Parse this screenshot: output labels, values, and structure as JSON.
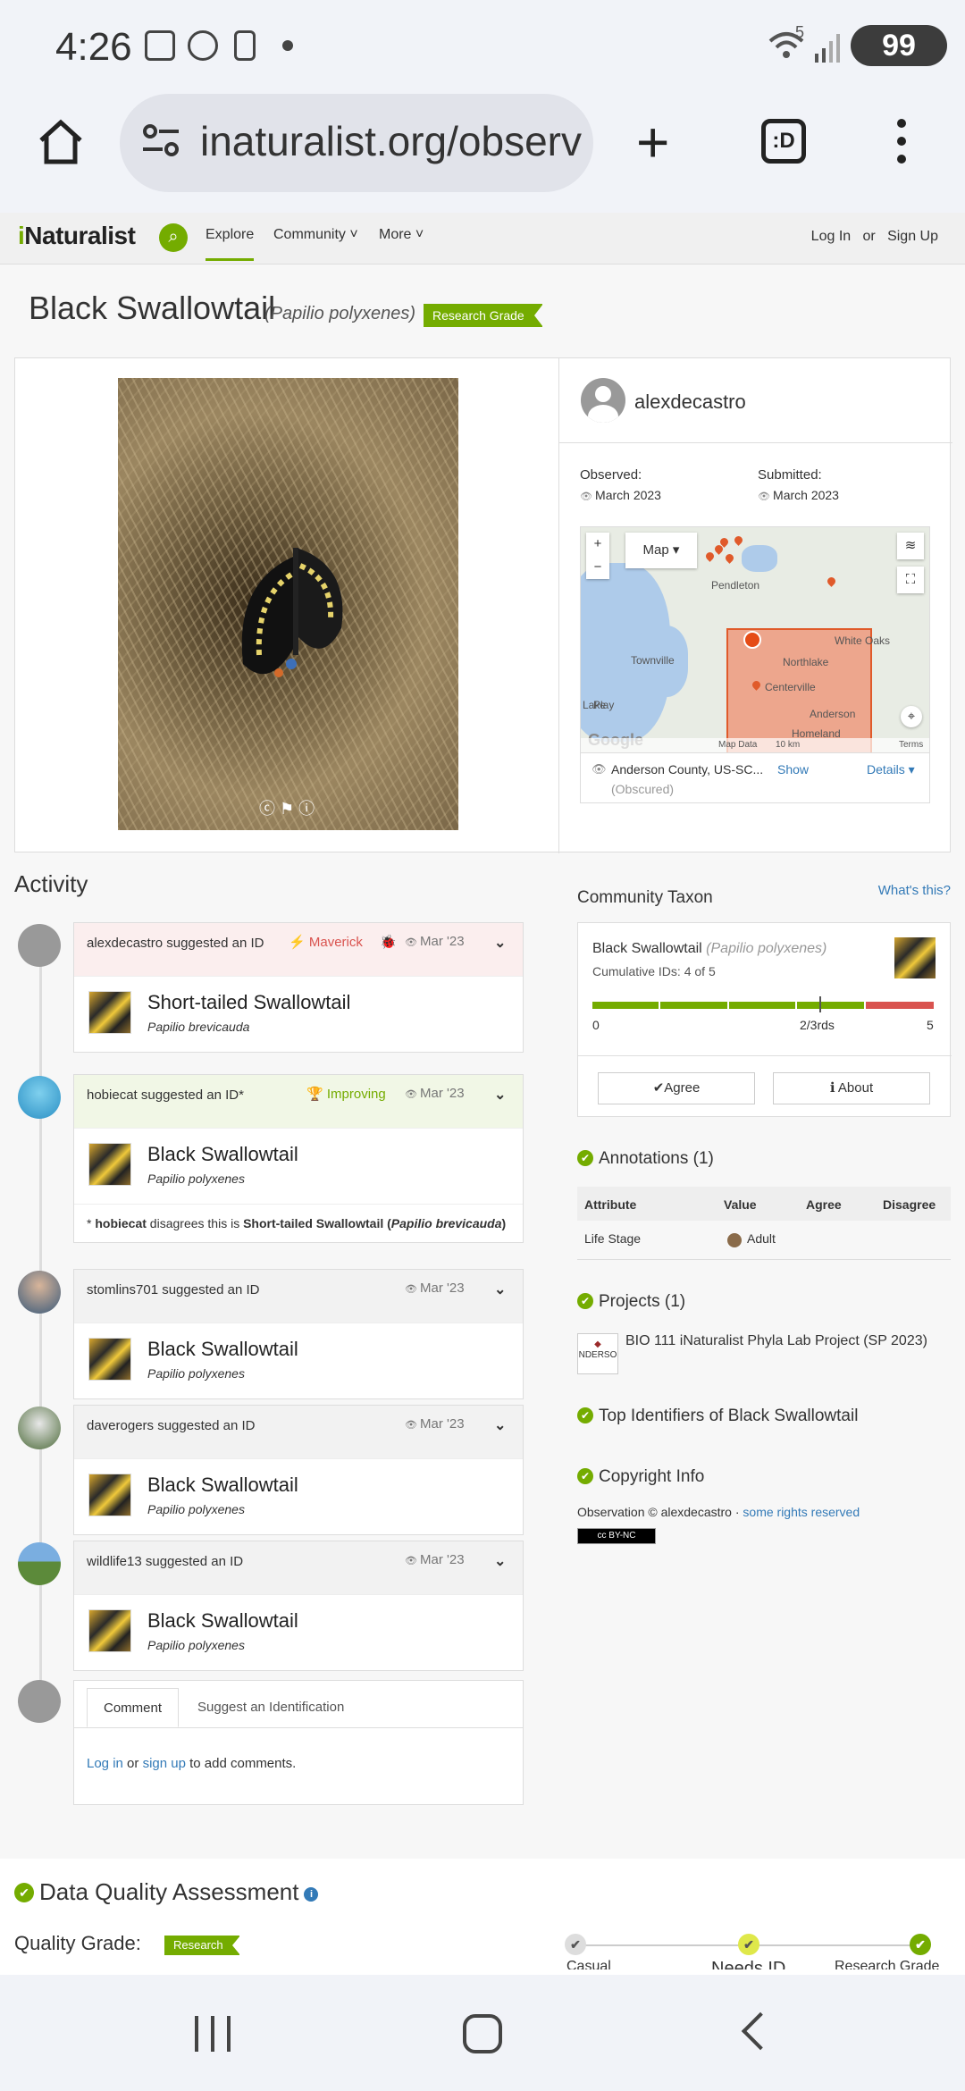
{
  "status": {
    "time": "4:26",
    "battery": "99",
    "signal_label": "5"
  },
  "browser": {
    "url": "inaturalist.org/observ"
  },
  "nav": {
    "logo_i": "i",
    "logo_rest": "Naturalist",
    "links": [
      "Explore",
      "Community ˅",
      "More ˅"
    ],
    "login": "Log In",
    "or": "or",
    "signup": "Sign Up"
  },
  "observation": {
    "common_name": "Black Swallowtail",
    "scientific_name": "(Papilio polyxenes)",
    "grade_badge": "Research Grade",
    "user": "alexdecastro",
    "observed_label": "Observed:",
    "observed_value": "March 2023",
    "submitted_label": "Submitted:",
    "submitted_value": "March 2023",
    "location": "Anderson County, US-SC...",
    "location_show": "Show",
    "location_details": "Details ▾",
    "location_obscured": "(Obscured)"
  },
  "map": {
    "type_button": "Map ▾",
    "zoom_in": "+",
    "zoom_out": "−",
    "labels": [
      "Pendleton",
      "Townville",
      "Northlake",
      "Centerville",
      "White Oaks",
      "Anderson",
      "Homeland",
      "Lake",
      "Play"
    ],
    "attribution": "Google",
    "map_data": "Map Data",
    "scale": "10 km",
    "terms": "Terms"
  },
  "activity": {
    "title": "Activity",
    "items": [
      {
        "user": "alexdecastro",
        "action": " suggested an ID",
        "badge": "Maverick",
        "badge_color": "#d9534f",
        "date": "Mar '23",
        "common": "Short-tailed Swallowtail",
        "scientific": "Papilio brevicauda",
        "head_bg": "#fbeeee"
      },
      {
        "user": "hobiecat",
        "action": " suggested an ID*",
        "badge": "Improving",
        "badge_color": "#74ac00",
        "date": "Mar '23",
        "common": "Black Swallowtail",
        "scientific": "Papilio polyxenes",
        "head_bg": "#f1f7e6",
        "note_prefix": "* ",
        "note_user": "hobiecat",
        "note_mid": " disagrees this is ",
        "note_taxon": "Short-tailed Swallowtail (",
        "note_sci": "Papilio brevicauda",
        "note_end": ")"
      },
      {
        "user": "stomlins701",
        "action": " suggested an ID",
        "badge": "",
        "date": "Mar '23",
        "common": "Black Swallowtail",
        "scientific": "Papilio polyxenes",
        "head_bg": "#f2f2f2"
      },
      {
        "user": "daverogers",
        "action": " suggested an ID",
        "badge": "",
        "date": "Mar '23",
        "common": "Black Swallowtail",
        "scientific": "Papilio polyxenes",
        "head_bg": "#f2f2f2"
      },
      {
        "user": "wildlife13",
        "action": " suggested an ID",
        "badge": "",
        "date": "Mar '23",
        "common": "Black Swallowtail",
        "scientific": "Papilio polyxenes",
        "head_bg": "#f2f2f2"
      }
    ],
    "comment_tab": "Comment",
    "suggest_tab": "Suggest an Identification",
    "login_link": "Log in",
    "or_text": " or ",
    "signup_link": "sign up",
    "to_add": " to add comments."
  },
  "community": {
    "title": "Community Taxon",
    "whats_this": "What's this?",
    "common": "Black Swallowtail",
    "scientific": "(Papilio polyxenes)",
    "cumulative": "Cumulative IDs: 4 of 5",
    "agree_ids": 4,
    "total_ids": 5,
    "bar_min": "0",
    "bar_mid": "2/3rds",
    "bar_max": "5",
    "agree_btn": "✔Agree",
    "about_btn": "ℹ About"
  },
  "annotations": {
    "title": "Annotations (1)",
    "headers": [
      "Attribute",
      "Value",
      "Agree",
      "Disagree"
    ],
    "rows": [
      {
        "attribute": "Life Stage",
        "value": "Adult"
      }
    ]
  },
  "projects": {
    "title": "Projects (1)",
    "thumb_text": "NDERSO",
    "name": "BIO 111 iNaturalist Phyla Lab Project (SP 2023)"
  },
  "top_identifiers": {
    "title": "Top Identifiers of Black Swallowtail"
  },
  "copyright": {
    "title": "Copyright Info",
    "text": "Observation © alexdecastro · ",
    "link": "some rights reserved",
    "badge": "cc BY-NC"
  },
  "dqa": {
    "title": "Data Quality Assessment",
    "quality_label": "Quality Grade:",
    "quality_badge": "Research",
    "steps": [
      "Casual",
      "Needs ID",
      "Research Grade"
    ]
  },
  "colors": {
    "brand": "#74ac00",
    "link": "#337ab7",
    "maverick": "#d9534f"
  }
}
